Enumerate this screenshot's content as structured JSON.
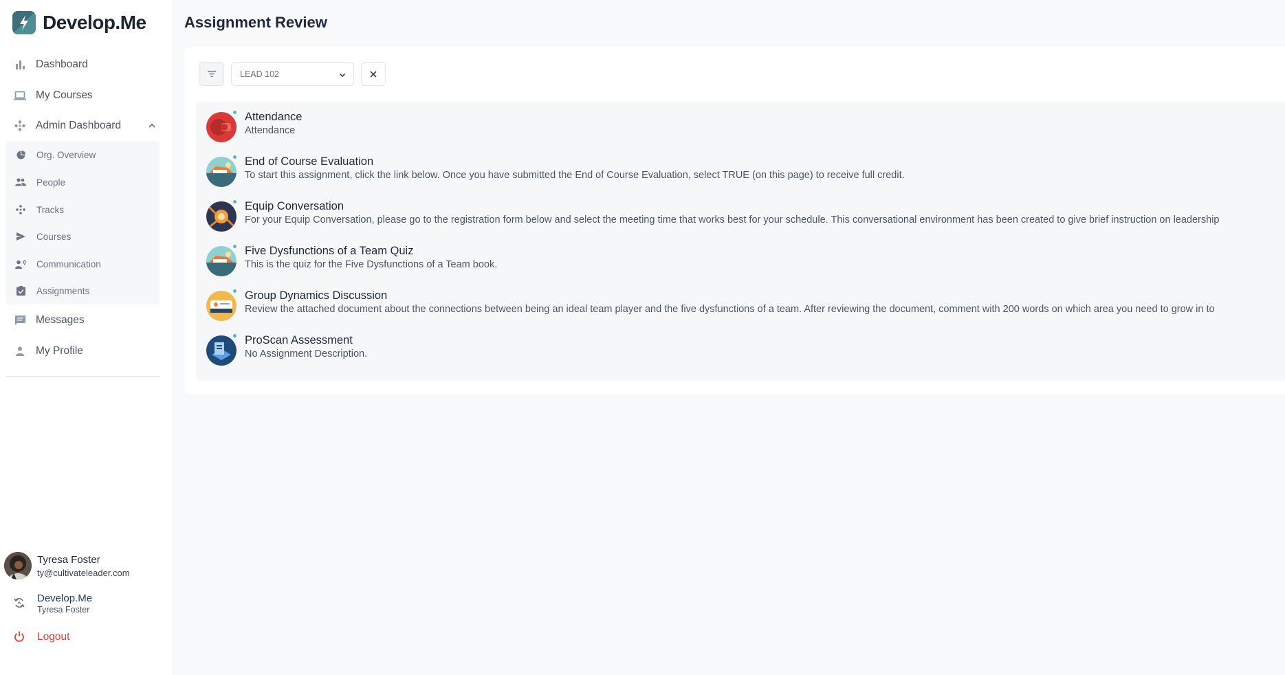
{
  "app": {
    "name": "Develop.Me"
  },
  "nav": {
    "items": [
      {
        "label": "Dashboard",
        "icon": "bar-chart-icon"
      },
      {
        "label": "My Courses",
        "icon": "laptop-icon"
      },
      {
        "label": "Admin Dashboard",
        "icon": "hub-icon"
      },
      {
        "label": "Messages",
        "icon": "message-icon"
      },
      {
        "label": "My Profile",
        "icon": "person-icon"
      }
    ],
    "admin_submenu": [
      {
        "label": "Org. Overview",
        "icon": "pie-chart-icon"
      },
      {
        "label": "People",
        "icon": "people-icon"
      },
      {
        "label": "Tracks",
        "icon": "tracks-icon"
      },
      {
        "label": "Courses",
        "icon": "send-icon"
      },
      {
        "label": "Communication",
        "icon": "voice-icon"
      },
      {
        "label": "Assignments",
        "icon": "clipboard-check-icon"
      }
    ]
  },
  "user": {
    "name": "Tyresa Foster",
    "email": "ty@cultivateleader.com"
  },
  "org": {
    "name": "Develop.Me",
    "user": "Tyresa Foster"
  },
  "logout_label": "Logout",
  "page": {
    "title": "Assignment Review"
  },
  "filters": {
    "course_value": "LEAD 102"
  },
  "assignments": [
    {
      "title": "Attendance",
      "description": "Attendance"
    },
    {
      "title": "End of Course Evaluation",
      "description": "To start this assignment, click the link below. Once you have submitted the End of Course Evaluation, select TRUE (on this page) to receive full credit."
    },
    {
      "title": "Equip Conversation",
      "description": "For your Equip Conversation, please go to the registration form below and select the meeting time that works best for your schedule. This conversational environment has been created to give brief instruction on leadership"
    },
    {
      "title": "Five Dysfunctions of a Team Quiz",
      "description": "This is the quiz for the Five Dysfunctions of a Team book."
    },
    {
      "title": "Group Dynamics Discussion",
      "description": "Review the attached document about the connections between being an ideal team player and the five dysfunctions of a team. After reviewing the document, comment with 200 words on which area you need to grow in to"
    },
    {
      "title": "ProScan Assessment",
      "description": "No Assignment Description."
    }
  ],
  "colors": {
    "accent": "#4fb8c8",
    "logout": "#e53935",
    "logo_bg": "#3f6f78"
  }
}
